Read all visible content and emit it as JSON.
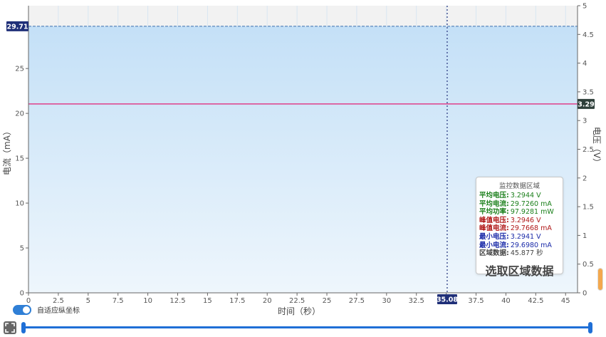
{
  "chart_data": {
    "type": "line",
    "xlabel": "时间（秒）",
    "ylabel_left": "电流（mA）",
    "ylabel_right": "电压（V）",
    "xlim": [
      0,
      46
    ],
    "ylim_left": [
      0,
      32
    ],
    "ylim_right": [
      0,
      5
    ],
    "x_ticks": [
      "0",
      "2.5",
      "5",
      "7.5",
      "10",
      "12.5",
      "15",
      "17.5",
      "20",
      "22.5",
      "25",
      "27.5",
      "30",
      "32.5",
      "35",
      "37.5",
      "40",
      "42.5",
      "45"
    ],
    "y_left_ticks": [
      "0",
      "5",
      "10",
      "15",
      "20",
      "25"
    ],
    "y_right_ticks": [
      "0",
      "0.5",
      "1",
      "1.5",
      "2",
      "2.5",
      "3",
      "3.5",
      "4",
      "4.5",
      "5"
    ],
    "series": [
      {
        "name": "电流",
        "color": "#6aa6e0",
        "fill": "#cfe5f8",
        "values_x": [
          0,
          46
        ],
        "values_y": [
          29.71,
          29.71
        ]
      },
      {
        "name": "电压",
        "color": "#e0408a",
        "values_x": [
          0,
          46
        ],
        "values_y": [
          3.29,
          3.29
        ]
      }
    ],
    "current_marker_label": "29.71",
    "voltage_marker_label": "3.29",
    "cursor_x_value": 35.08,
    "cursor_x_label": "35.08",
    "grid": true
  },
  "toggle": {
    "label": "自适应纵坐标",
    "on": true
  },
  "info_panel": {
    "title": "监控数据区域",
    "rows": [
      {
        "label": "平均电压:",
        "value": "3.2944 V",
        "color": "#1a7f1a"
      },
      {
        "label": "平均电流:",
        "value": "29.7260 mA",
        "color": "#1a7f1a"
      },
      {
        "label": "平均功率:",
        "value": "97.9281 mW",
        "color": "#1a7f1a"
      },
      {
        "label": "峰值电压:",
        "value": "3.2946 V",
        "color": "#b01818"
      },
      {
        "label": "峰值电流:",
        "value": "29.7668 mA",
        "color": "#b01818"
      },
      {
        "label": "最小电压:",
        "value": "3.2941 V",
        "color": "#1a2aa8"
      },
      {
        "label": "最小电流:",
        "value": "29.6980 mA",
        "color": "#1a2aa8"
      },
      {
        "label": "区域数据:",
        "value": "45.877 秒",
        "color": "#444444"
      }
    ],
    "select_label": "选取区域数据"
  },
  "slider": {
    "start_fraction": 0.0,
    "end_fraction": 1.0
  },
  "icons": {
    "expand": "expand-icon"
  }
}
